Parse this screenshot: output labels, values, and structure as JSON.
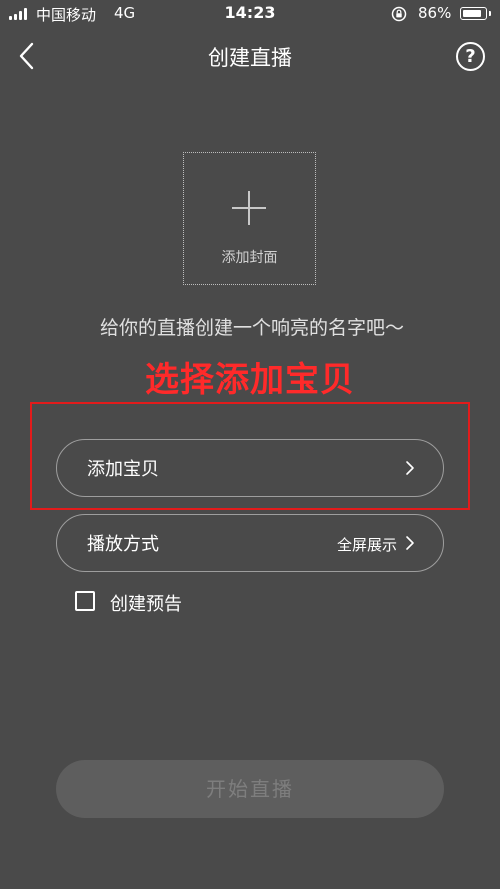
{
  "status_bar": {
    "carrier": "中国移动",
    "network": "4G",
    "time": "14:23",
    "battery_percent": "86%",
    "battery_level": 0.86,
    "icons": [
      "signal-icon",
      "orientation-lock-icon",
      "battery-icon"
    ]
  },
  "nav": {
    "title": "创建直播",
    "back_icon": "chevron-left-icon",
    "help_label": "?"
  },
  "cover": {
    "label": "添加封面",
    "icon": "plus-icon"
  },
  "title_input": {
    "placeholder": "给你的直播创建一个响亮的名字吧～",
    "value": ""
  },
  "annotation": {
    "text": "选择添加宝贝",
    "color": "#ff2a2a"
  },
  "rows": {
    "add_item": {
      "label": "添加宝贝"
    },
    "play_mode": {
      "label": "播放方式",
      "value": "全屏展示"
    }
  },
  "preview": {
    "label": "创建预告",
    "checked": false
  },
  "start_button": {
    "label": "开始直播"
  },
  "colors": {
    "background": "#4a4a4a",
    "start_button_bg": "#5e5e5e",
    "start_button_text": "#7e7e7e"
  }
}
